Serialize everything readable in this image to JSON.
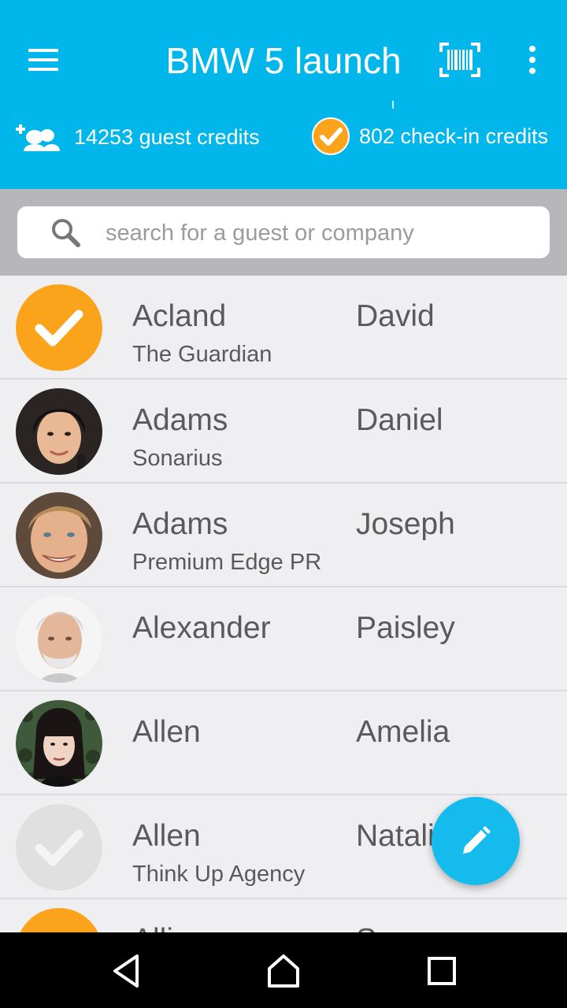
{
  "app_bar": {
    "title": "BMW 5 launch",
    "guest_credits_label": "14253 guest credits",
    "checkin_credits_label": "802 check-in credits",
    "background_color": "#00b6eb",
    "icons": [
      "menu-icon",
      "barcode-icon",
      "more-vert-icon",
      "add-guests-icon",
      "check-icon"
    ]
  },
  "search": {
    "placeholder": "search for a guest or company",
    "value": ""
  },
  "guests": [
    {
      "last": "Acland",
      "first": "David",
      "company": "The Guardian",
      "avatar": "checked-in-badge"
    },
    {
      "last": "Adams",
      "first": "Daniel",
      "company": "Sonarius",
      "avatar": "photo"
    },
    {
      "last": "Adams",
      "first": "Joseph",
      "company": "Premium Edge PR",
      "avatar": "photo"
    },
    {
      "last": "Alexander",
      "first": "Paisley",
      "company": "",
      "avatar": "photo"
    },
    {
      "last": "Allen",
      "first": "Amelia",
      "company": "",
      "avatar": "photo"
    },
    {
      "last": "Allen",
      "first": "Natali",
      "company": "Think Up Agency",
      "avatar": "not-checked-in-badge"
    },
    {
      "last": "Alli",
      "first": "S",
      "company": "",
      "avatar": "checked-in-badge"
    }
  ],
  "colors": {
    "accent": "#00b6eb",
    "checked_in": "#fba31b",
    "not_checked_in": "#e0e0e0",
    "fab": "#14bbec"
  },
  "fab": {
    "icon": "edit-pencil-icon"
  },
  "system_nav": {
    "icons": [
      "back-icon",
      "home-icon",
      "recents-icon"
    ]
  }
}
